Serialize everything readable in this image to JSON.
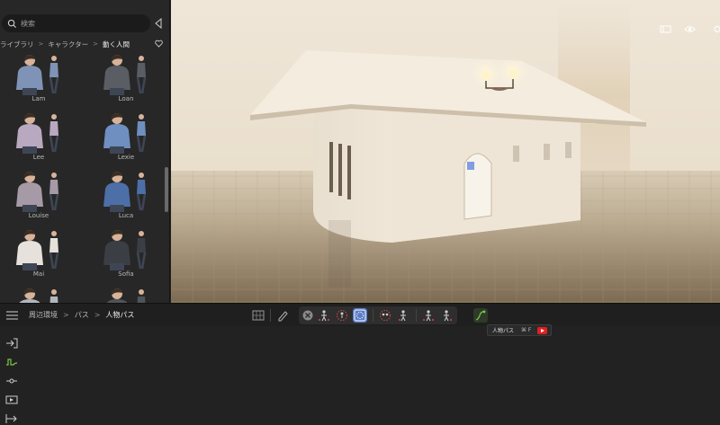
{
  "library": {
    "search_placeholder": "検索",
    "breadcrumb": [
      "ライブラリ",
      "キャラクター",
      "動く人間"
    ],
    "characters": [
      {
        "name": "Lam",
        "shirt": "#7f93b6"
      },
      {
        "name": "Loan",
        "shirt": "#5a5d64"
      },
      {
        "name": "Lee",
        "shirt": "#b9a9c0"
      },
      {
        "name": "Lexie",
        "shirt": "#6f8fc0"
      },
      {
        "name": "Louise",
        "shirt": "#a59aa6"
      },
      {
        "name": "Luca",
        "shirt": "#4d6fa8"
      },
      {
        "name": "Mai",
        "shirt": "#e6e1db"
      },
      {
        "name": "Sofia",
        "shirt": "#3b3f45"
      },
      {
        "name": "",
        "shirt": "#b1b6be"
      },
      {
        "name": "",
        "shirt": "#505459"
      }
    ]
  },
  "bottombar": {
    "breadcrumb": [
      "周辺環境",
      "パス",
      "人物パス"
    ]
  },
  "tooltip": {
    "label": "人物パス",
    "shortcut": "⌘ F"
  },
  "colors": {
    "accent_green": "#7ac943",
    "active_blue": "#5b7cc8",
    "panel": "#272727"
  },
  "icons": [
    "search-icon",
    "collapse-icon",
    "heart-icon",
    "layout-icon",
    "eye-icon",
    "menu-icon",
    "grid-tool-icon",
    "pen-tool-icon",
    "close-icon",
    "person-path-icon",
    "import-icon",
    "path-icon",
    "node-icon",
    "video-icon",
    "export-icon"
  ]
}
